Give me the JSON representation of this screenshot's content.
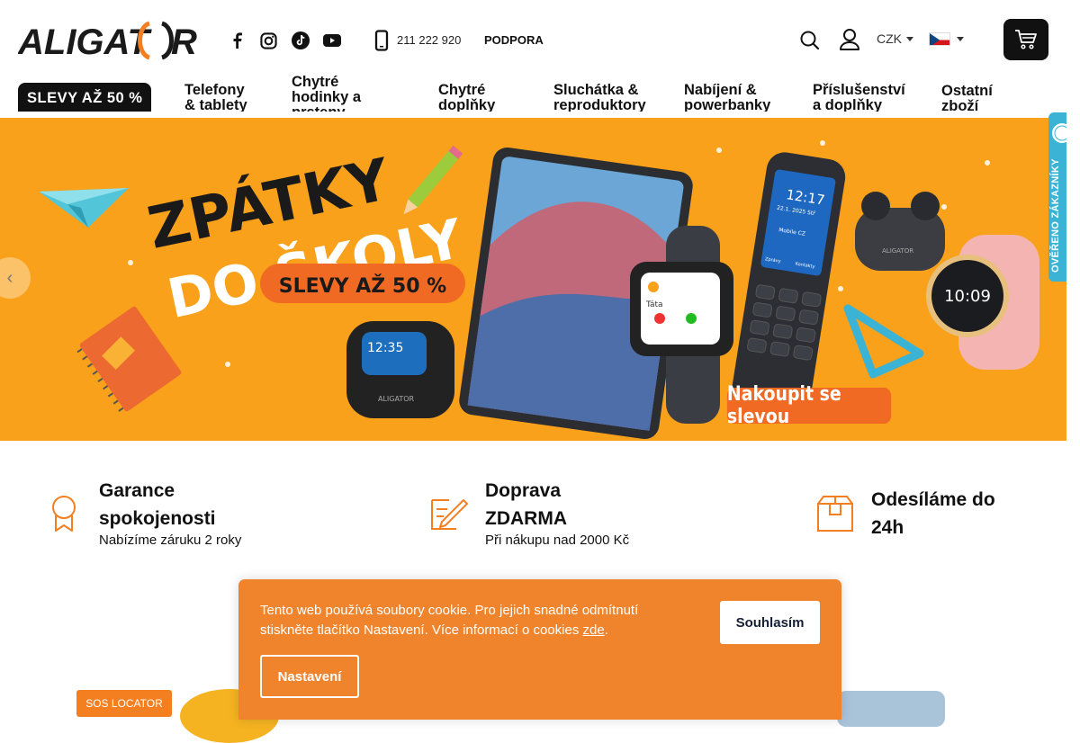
{
  "header": {
    "logo_text": "ALIGATOR",
    "phone": "211 222 920",
    "support_label": "PODPORA",
    "currency": "CZK",
    "social_icons": [
      "facebook-icon",
      "instagram-icon",
      "tiktok-icon",
      "youtube-icon"
    ]
  },
  "nav": {
    "sale_label": "SLEVY AŽ 50 %",
    "items": [
      {
        "line1": "Telefony",
        "line2": "& tablety"
      },
      {
        "line1": "Chytré",
        "line2": "hodinky a",
        "line3": "prsteny"
      },
      {
        "line1": "Chytré",
        "line2": "doplňky"
      },
      {
        "line1": "Sluchátka &",
        "line2": "reproduktory"
      },
      {
        "line1": "Nabíjení &",
        "line2": "powerbanky"
      },
      {
        "line1": "Příslušenství",
        "line2": "a doplňky"
      },
      {
        "line1": "Ostatní",
        "line2": "zboží"
      }
    ]
  },
  "hero": {
    "title_line1": "ZPÁTKY",
    "title_line2": "DO ŠKOLY",
    "sale_badge": "SLEVY AŽ 50 %",
    "cta_label": "Nakoupit se slevou",
    "phone_time": "12:17",
    "phone_date": "22.1. 2025 Stř",
    "phone_operator": "Mobile CZ",
    "phone_softkey_left": "Zprávy",
    "phone_softkey_right": "Kontakty",
    "device_brand": "ALIGATOR",
    "watch_time": "10:09",
    "mini_watch_time": "12:35",
    "kids_watch_label": "Táta",
    "prev_arrow": "‹"
  },
  "verified_badge": {
    "label": "OVĚŘENO ZÁKAZNÍKY"
  },
  "benefits": [
    {
      "icon": "ribbon-icon",
      "title_line1": "Garance",
      "title_line2": "spokojenosti",
      "subtitle": "Nabízíme záruku 2 roky"
    },
    {
      "icon": "pencil-icon",
      "title_line1": "Doprava",
      "title_line2": "ZDARMA",
      "subtitle": "Při nákupu nad 2000 Kč"
    },
    {
      "icon": "box-icon",
      "title_line1": "Odesíláme do",
      "title_line2": "24h",
      "subtitle": ""
    }
  ],
  "cookie": {
    "text": "Tento web používá soubory cookie. Pro jejich snadné odmítnutí stiskněte tlačítko Nastavení. Více informací o cookies ",
    "link_label": "zde",
    "period": ".",
    "accept_label": "Souhlasím",
    "settings_label": "Nastavení"
  },
  "products": {
    "sos_badge": "SOS LOCATOR"
  },
  "colors": {
    "brand_orange": "#f9a11b",
    "cookie_bg": "#f0842c",
    "accent_orange": "#f37f21",
    "dark": "#111111",
    "teal": "#3bb3d4"
  }
}
